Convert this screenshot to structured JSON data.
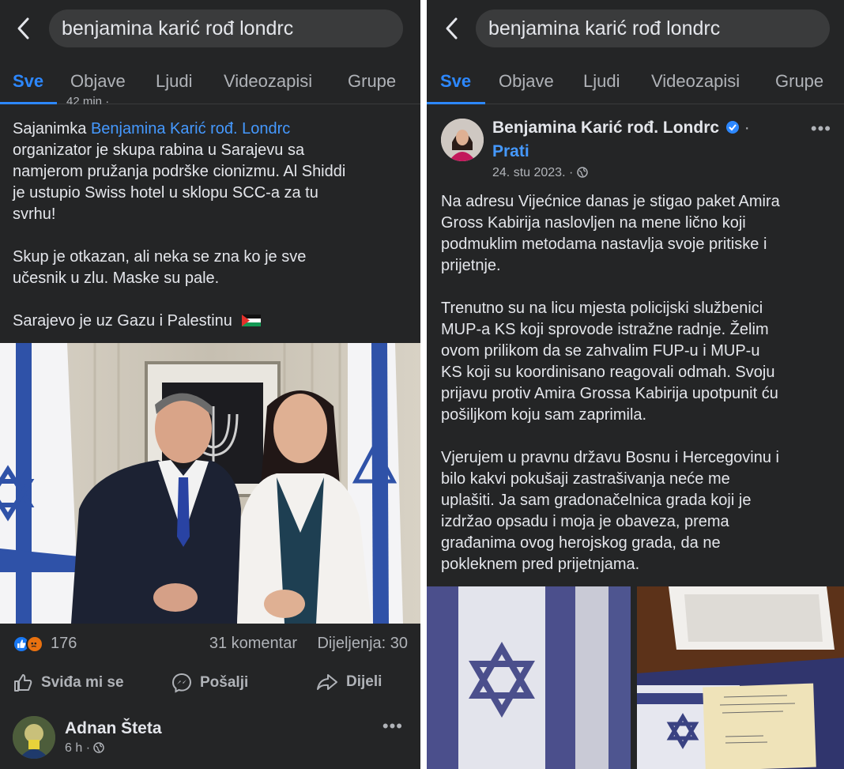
{
  "left": {
    "search_query": "benjamina karić rođ londrc",
    "tabs": [
      "Sve",
      "Objave",
      "Ljudi",
      "Videozapisi",
      "Grupe"
    ],
    "timestamp_partial": "42 min ·",
    "post": {
      "lines": [
        [
          "Sajanimka ",
          "Benjamina Karić rođ. Londrc"
        ],
        "organizator je skupa rabina u Sarajevu sa",
        "namjerom pružanja podrške cionizmu. Al Shiddi",
        "je ustupio Swiss hotel u sklopu SCC-a za tu",
        "svrhu!",
        "Skup je otkazan, ali neka se zna ko je sve",
        "učesnik u zlu. Maske su pale.",
        "Sarajevo je uz Gazu i Palestinu 🇵🇸"
      ],
      "line1_prefix": "Sajanimka ",
      "line1_link": "Benjamina Karić rođ. Londrc",
      "line2": "organizator je skupa rabina u Sarajevu sa",
      "line3": "namjerom pružanja podrške cionizmu. Al Shiddi",
      "line4": "je ustupio Swiss hotel u sklopu SCC-a za tu",
      "line5": "svrhu!",
      "line6": "Skup je otkazan, ali neka se zna ko je sve",
      "line7": "učesnik u zlu. Maske su pale.",
      "line8": "Sarajevo je uz Gazu i Palestinu"
    },
    "reaction_count": "176",
    "comments": "31 komentar",
    "shares": "Dijeljenja: 30",
    "actions": {
      "like": "Sviđa mi se",
      "send": "Pošalji",
      "share": "Dijeli"
    },
    "commenter": {
      "name": "Adnan Šteta",
      "time": "6 h ·"
    }
  },
  "right": {
    "search_query": "benjamina karić rođ londrc",
    "tabs": [
      "Sve",
      "Objave",
      "Ljudi",
      "Videozapisi",
      "Grupe"
    ],
    "author": "Benjamina Karić rođ. Londrc",
    "follow": "Prati",
    "date": "24. stu 2023. ·",
    "post": {
      "p1": [
        "Na adresu Vijećnice danas je stigao paket Amira",
        "Gross Kabirija naslovljen na mene lično koji",
        "podmuklim metodama nastavlja svoje pritiske i",
        "prijetnje."
      ],
      "p2": [
        "Trenutno su na licu mjesta policijski službenici",
        "MUP-a KS koji sprovode istražne radnje. Želim",
        "ovom prilikom da se zahvalim FUP-u i MUP-u",
        "KS koji su koordinisano reagovali odmah. Svoju",
        "prijavu protiv Amira Grossa Kabirija upotpunit ću",
        "pošiljkom koju sam zaprimila."
      ],
      "p3": [
        "Vjerujem u pravnu državu Bosnu i Hercegovinu i",
        "bilo kakvi pokušaji zastrašivanja neće me",
        "uplašiti. Ja sam gradonačelnica grada koji je",
        "izdržao opsadu i moja je obaveza, prema",
        "građanima ovog herojskog grada, da ne",
        "pokleknem pred prijetnjama."
      ]
    }
  },
  "colors": {
    "background": "#242526",
    "text": "#e4e6eb",
    "muted": "#b0b3b8",
    "accent": "#2d88ff",
    "link": "#4599ff",
    "search_field": "#3a3b3c"
  },
  "icons": [
    "back-arrow-icon",
    "globe-icon",
    "like-reaction-icon",
    "angry-reaction-icon",
    "thumbs-up-icon",
    "messenger-icon",
    "share-icon",
    "verified-badge-icon",
    "more-options-icon"
  ]
}
